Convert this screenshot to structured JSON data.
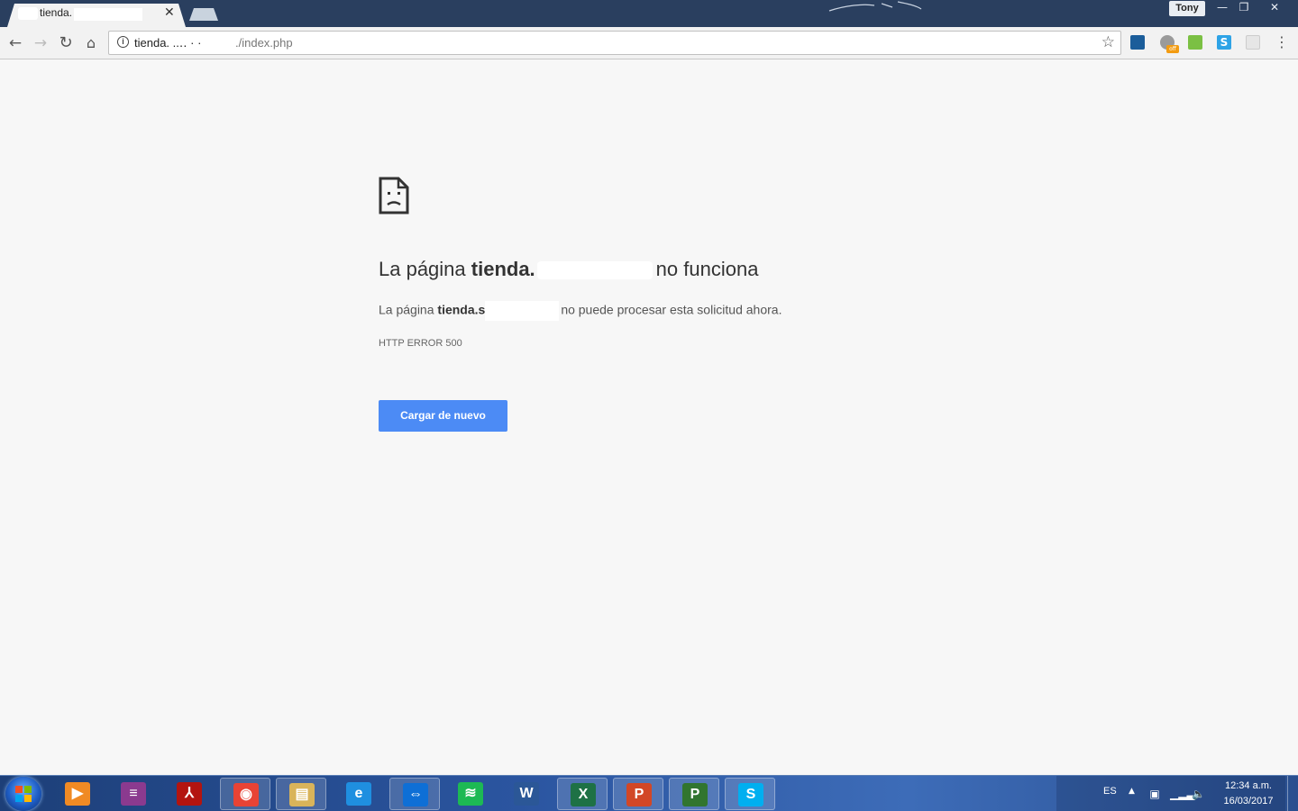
{
  "browser": {
    "tab_title": "tienda.",
    "profile_name": "Tony",
    "url_host": "tienda. ..‥ ·  ·",
    "url_path": "./index.php"
  },
  "error": {
    "heading_prefix": "La página ",
    "heading_host": "tienda.",
    "heading_suffix": "no funciona",
    "desc_prefix": "La página ",
    "desc_host": "tienda.s",
    "desc_suffix": "no puede procesar esta solicitud ahora.",
    "code": "HTTP ERROR 500",
    "reload_label": "Cargar de nuevo"
  },
  "taskbar": {
    "apps": [
      {
        "name": "windows-media-player",
        "label": "▶",
        "color": "#f08a24"
      },
      {
        "name": "winrar",
        "label": "≡",
        "color": "#8b3a8f"
      },
      {
        "name": "adobe-reader",
        "label": "⅄",
        "color": "#b3140f"
      },
      {
        "name": "google-chrome",
        "label": "◉",
        "color": "#e84335"
      },
      {
        "name": "windows-explorer",
        "label": "▤",
        "color": "#d9b45a"
      },
      {
        "name": "internet-explorer",
        "label": "e",
        "color": "#1f8fe0"
      },
      {
        "name": "teamviewer",
        "label": "⇔",
        "color": "#0e6fd6"
      },
      {
        "name": "spotify",
        "label": "≋",
        "color": "#1db954"
      },
      {
        "name": "word",
        "label": "W",
        "color": "#2b5797"
      },
      {
        "name": "excel",
        "label": "X",
        "color": "#1e7145"
      },
      {
        "name": "powerpoint",
        "label": "P",
        "color": "#d24726"
      },
      {
        "name": "project",
        "label": "P",
        "color": "#31752f"
      },
      {
        "name": "skype",
        "label": "S",
        "color": "#00aff0"
      }
    ],
    "tray": {
      "language": "ES",
      "time": "12:34 a.m.",
      "date": "16/03/2017"
    }
  }
}
